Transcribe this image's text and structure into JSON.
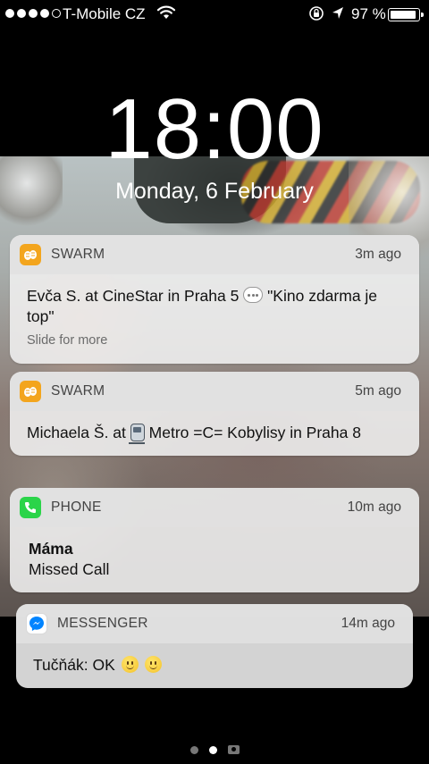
{
  "status_bar": {
    "carrier": "T-Mobile CZ",
    "battery_percent": "97 %",
    "battery_level": 0.97,
    "signal_bars_filled": 4,
    "signal_bars_total": 5
  },
  "lock_screen": {
    "time": "18:00",
    "date": "Monday, 6 February"
  },
  "notifications": [
    {
      "app": "SWARM",
      "app_icon": "swarm-icon",
      "ago": "3m ago",
      "text_before": "Evča S. at CineStar in Praha 5",
      "text_after": "\"Kino zdarma je top\"",
      "hint": "Slide for more"
    },
    {
      "app": "SWARM",
      "app_icon": "swarm-icon",
      "ago": "5m ago",
      "text_before": "Michaela Š. at",
      "text_after": "Metro =C= Kobylisy in Praha 8"
    },
    {
      "app": "PHONE",
      "app_icon": "phone-icon",
      "ago": "10m ago",
      "sender": "Máma",
      "text": "Missed Call"
    },
    {
      "app": "MESSENGER",
      "app_icon": "messenger-icon",
      "ago": "14m ago",
      "text": "Tučňák: OK"
    }
  ],
  "colors": {
    "swarm": "#f3a51d",
    "phone": "#2bd449",
    "messenger": "#0084ff"
  }
}
